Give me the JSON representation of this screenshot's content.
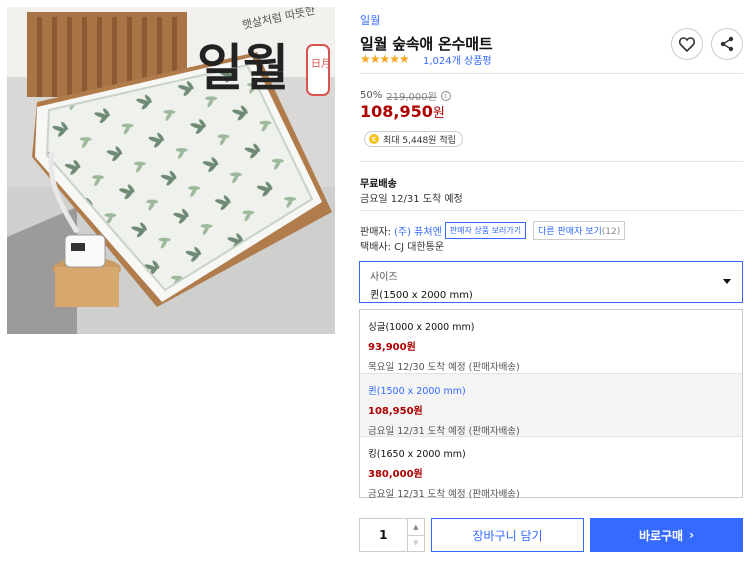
{
  "image": {
    "logo_main": "일월",
    "logo_sub": "햇살처럼 따뜻한",
    "logo_stamp": "日月"
  },
  "product": {
    "brand": "일월",
    "title": "일월 숲속애 온수매트",
    "rating": 4.5,
    "stars_text": "★★★★★",
    "review_count": "1,024개 상품평"
  },
  "pricing": {
    "discount": "50%",
    "original": "219,000원",
    "info_icon": "i",
    "price_num": "108,950",
    "price_unit": "원",
    "cash_icon": "c",
    "cashback": "최대 5,448원 적립"
  },
  "shipping": {
    "title": "무료배송",
    "eta": "금요일 12/31 도착 예정"
  },
  "seller": {
    "label": "판매자:",
    "name": "(주) 퓨쳐엔",
    "view_products": "판매자 상품 보러가기",
    "other_label": "다른 판매자 보기",
    "other_count": "(12)",
    "courier": "택배사: CJ 대한통운"
  },
  "option_select": {
    "label": "사이즈",
    "selected": "퀸(1500 x 2000 mm)"
  },
  "options": [
    {
      "name": "싱글(1000 x 2000 mm)",
      "price": "93,900원",
      "delivery": "목요일 12/30 도착 예정 (판매자배송)"
    },
    {
      "name": "퀸(1500 x 2000 mm)",
      "price": "108,950원",
      "delivery": "금요일 12/31 도착 예정 (판매자배송)"
    },
    {
      "name": "킹(1650 x 2000 mm)",
      "price": "380,000원",
      "delivery": "금요일 12/31 도착 예정 (판매자배송)"
    }
  ],
  "purchase": {
    "quantity": "1",
    "up": "▲",
    "down": "▼",
    "cart": "장바구니 담기",
    "buy": "바로구매",
    "buy_arrow": "›"
  },
  "colors": {
    "accent": "#346aff",
    "price": "#ae0000",
    "star": "#f5a623"
  }
}
